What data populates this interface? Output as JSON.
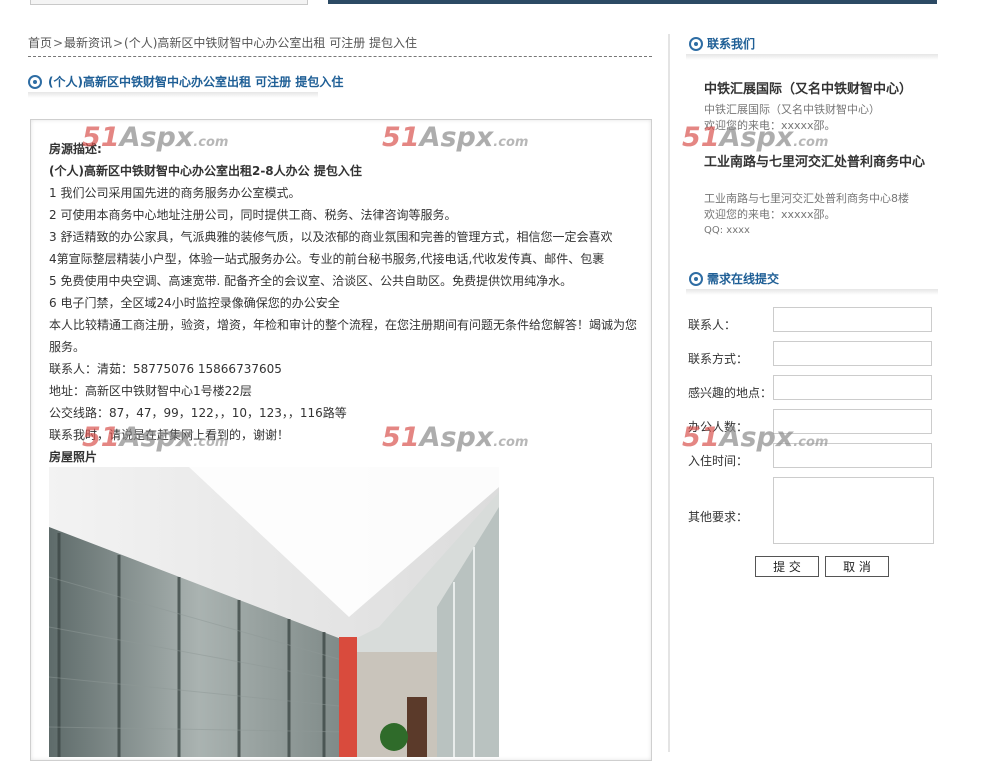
{
  "breadcrumb": {
    "home": "首页",
    "news": "最新资讯",
    "current": "(个人)高新区中铁财智中心办公室出租 可注册 提包入住"
  },
  "article": {
    "title": "(个人)高新区中铁财智中心办公室出租 可注册 提包入住",
    "desc_heading": "房源描述:",
    "subtitle": "(个人)高新区中铁财智中心办公室出租2-8人办公 提包入住",
    "lines": [
      "1 我们公司采用国先进的商务服务办公室模式。",
      "2 可使用本商务中心地址注册公司，同时提供工商、税务、法律咨询等服务。",
      "3 舒适精致的办公家具，气派典雅的装修气质，以及浓郁的商业氛围和完善的管理方式，相信您一定会喜欢",
      "4第宣际整层精装小户型，体验一站式服务办公。专业的前台秘书服务,代接电话,代收发传真、邮件、包裹",
      "5 免费使用中央空调、高速宽带. 配备齐全的会议室、洽谈区、公共自助区。免费提供饮用纯净水。",
      "6 电子门禁，全区域24小时监控录像确保您的办公安全"
    ],
    "paragraph": "本人比较精通工商注册，验资，增资，年检和审计的整个流程，在您注册期间有问题无条件给您解答！竭诚为您服务。",
    "contact": "联系人：清茹：58775076  15866737605",
    "address": "地址：高新区中铁财智中心1号楼22层",
    "bus": "公交线路：87，47，99，122，，10，123，，116路等",
    "closing": "联系我时，请说是在赶集网上看到的，谢谢！",
    "photo_heading": "房屋照片"
  },
  "sidebar": {
    "contact_heading": "联系我们",
    "contacts": [
      {
        "title": "中铁汇展国际（又名中铁财智中心）",
        "line1": "中铁汇展国际（又名中铁财智中心）",
        "line2": "欢迎您的来电：xxxxx邵。"
      },
      {
        "title": "工业南路与七里河交汇处普利商务中心",
        "line1": "工业南路与七里河交汇处普利商务中心8楼",
        "line2": "欢迎您的来电：xxxxx邵。",
        "line3": "QQ: xxxx"
      }
    ],
    "form_heading": "需求在线提交",
    "form": {
      "contact_person": "联系人：",
      "contact_method": "联系方式：",
      "interest_location": "感兴趣的地点：",
      "office_people": "办公人数：",
      "move_in_time": "入住时间：",
      "other": "其他要求：",
      "submit": "提 交",
      "cancel": "取 消"
    }
  },
  "watermark": {
    "number": "51",
    "brand": "Aspx",
    "domain": ".com"
  },
  "colors": {
    "heading_blue": "#1f5f96",
    "top_bar": "#2c4a64",
    "watermark_red": "#d9534f"
  }
}
